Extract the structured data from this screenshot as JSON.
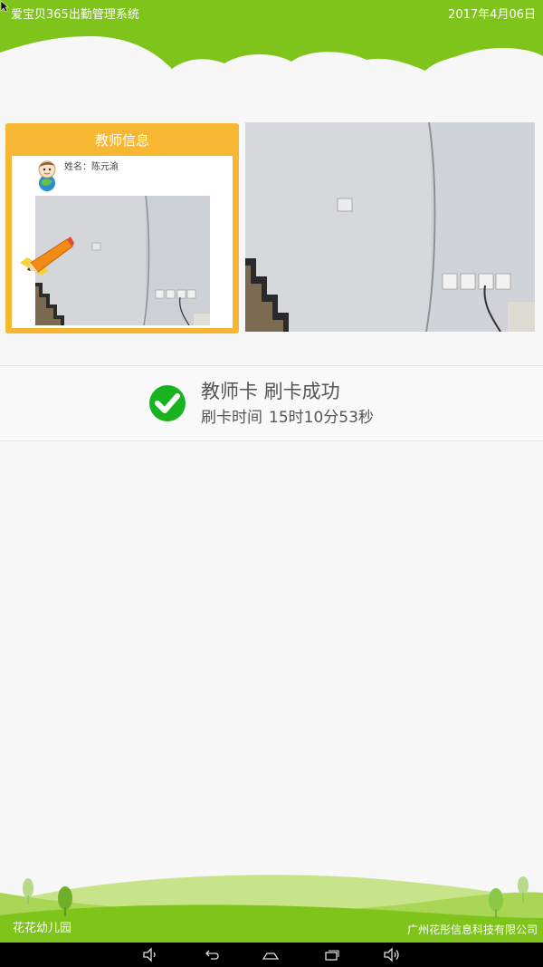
{
  "header": {
    "title": "爱宝贝365出勤管理系统",
    "date": "2017年4月06日"
  },
  "teacher_card": {
    "title": "教师信息",
    "name_label": "姓名：",
    "name_value": "陈元渝"
  },
  "result": {
    "status": "教师卡 刷卡成功",
    "time_label": "刷卡时间",
    "time_value": "15时10分53秒"
  },
  "footer": {
    "school": "花花幼儿园",
    "company": "广州花彤信息科技有限公司"
  },
  "colors": {
    "brand_green": "#7ec41a",
    "card_orange": "#f7b733",
    "success_green": "#19b320"
  },
  "icons": {
    "pencil": "pencil-icon",
    "avatar": "baby-avatar-icon",
    "check": "check-circle-icon",
    "cursor": "cursor-icon",
    "nav": [
      "volume-down-icon",
      "back-icon",
      "home-icon",
      "recent-apps-icon",
      "volume-up-icon"
    ]
  }
}
